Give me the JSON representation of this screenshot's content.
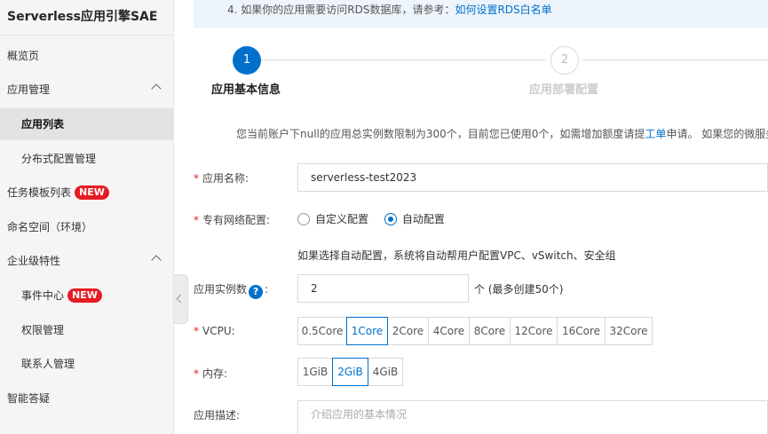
{
  "sidebar": {
    "title": "Serverless应用引擎SAE",
    "items": [
      {
        "label": "概览页"
      },
      {
        "label": "应用管理"
      },
      {
        "label": "应用列表"
      },
      {
        "label": "分布式配置管理"
      },
      {
        "label": "任务模板列表",
        "badge": "NEW"
      },
      {
        "label": "命名空间（环境）"
      },
      {
        "label": "企业级特性"
      },
      {
        "label": "事件中心",
        "badge": "NEW"
      },
      {
        "label": "权限管理"
      },
      {
        "label": "联系人管理"
      },
      {
        "label": "智能答疑"
      }
    ]
  },
  "notice": {
    "text": "4. 如果你的应用需要访问RDS数据库，请参考：",
    "link": "如何设置RDS白名单"
  },
  "steps": [
    {
      "number": "1",
      "label": "应用基本信息"
    },
    {
      "number": "2",
      "label": "应用部署配置"
    }
  ],
  "quota": {
    "before": "您当前账户下null的应用总实例数限制为300个，目前您已使用0个，如需增加额度请提",
    "link": "工单",
    "after": "申请。 如果您的微服务应用"
  },
  "form": {
    "app_name": {
      "label": "应用名称:",
      "value": "serverless-test2023"
    },
    "vpc": {
      "label": "专有网络配置:",
      "options": [
        "自定义配置",
        "自动配置"
      ],
      "selected": "自动配置",
      "note": "如果选择自动配置，系统将自动帮用户配置VPC、vSwitch、安全组"
    },
    "instances": {
      "label": "应用实例数",
      "help": "?",
      "colon": ":",
      "value": "2",
      "unit": "个",
      "max_note": "(最多创建50个)"
    },
    "vcpu": {
      "label": "VCPU:",
      "options": [
        "0.5Core",
        "1Core",
        "2Core",
        "4Core",
        "8Core",
        "12Core",
        "16Core",
        "32Core"
      ],
      "selected": "1Core"
    },
    "memory": {
      "label": "内存:",
      "options": [
        "1GiB",
        "2GiB",
        "4GiB"
      ],
      "selected": "2GiB"
    },
    "description": {
      "label": "应用描述:",
      "placeholder": "介绍应用的基本情况"
    }
  },
  "colors": {
    "accent": "#0070cc",
    "required": "#e51c23",
    "badge": "#e51c23"
  }
}
